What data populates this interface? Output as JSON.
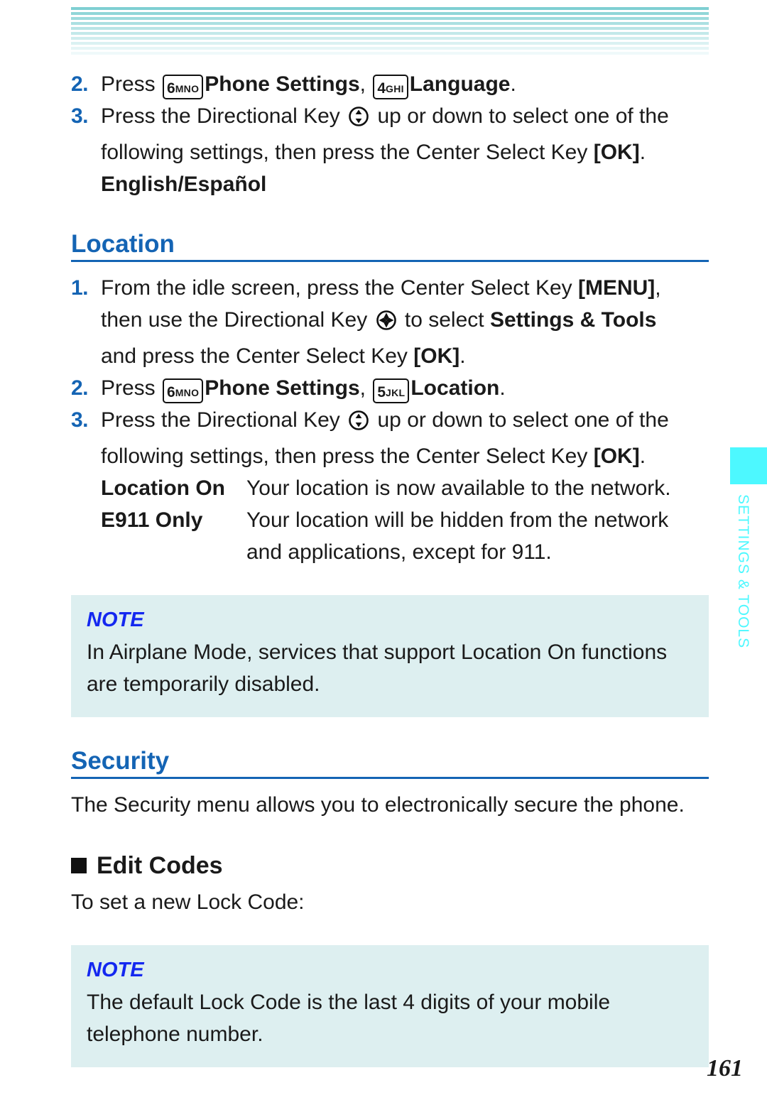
{
  "colors": {
    "heading_blue": "#1464b4",
    "note_label_blue": "#1428f0",
    "note_bg": "#ddeff0",
    "tab_cyan": "#4df8ff",
    "stripe_teal": "#7fcfd2"
  },
  "top_banner": {
    "kind": "striped-gradient-bar",
    "stripe_count": 10
  },
  "steps_language": [
    {
      "num": "2.",
      "pre": "Press ",
      "key1": {
        "num": "6",
        "letters": "MNO"
      },
      "bold1": "Phone Settings",
      "mid": ", ",
      "key2": {
        "num": "4",
        "letters": "GHI"
      },
      "bold2": "Language",
      "post": "."
    },
    {
      "num": "3.",
      "line1_pre": "Press the Directional Key ",
      "dirkey": "updown-dirkey-icon",
      "line1_post": " up or down to select one of the",
      "line2_pre": "following settings, then press the Center Select Key ",
      "line2_bold": "[OK]",
      "line2_post": "."
    }
  ],
  "language_option": "English/Español",
  "location_section": {
    "heading": "Location",
    "step1": {
      "num": "1.",
      "line1": "From the idle screen, press the Center Select Key ",
      "line1_bold": "[MENU]",
      "line1_post": ",",
      "line2_pre": "then use the Directional Key ",
      "dirkey": "fourway-dirkey-icon",
      "line2_mid": " to select ",
      "line2_bold": "Settings & Tools",
      "line3_pre": "and press the Center Select Key ",
      "line3_bold": "[OK]",
      "line3_post": "."
    },
    "step2": {
      "num": "2.",
      "pre": "Press ",
      "key1": {
        "num": "6",
        "letters": "MNO"
      },
      "bold1": "Phone Settings",
      "mid": ", ",
      "key2": {
        "num": "5",
        "letters": "JKL"
      },
      "bold2": "Location",
      "post": "."
    },
    "step3": {
      "num": "3.",
      "line1_pre": "Press the Directional Key ",
      "dirkey": "updown-dirkey-icon",
      "line1_post": " up or down to select one of the",
      "line2_pre": "following settings, then press the Center Select Key ",
      "line2_bold": "[OK]",
      "line2_post": "."
    },
    "options": [
      {
        "term": "Location On",
        "desc": "Your location is now available to the network."
      },
      {
        "term": "E911 Only",
        "desc": "Your location will be hidden from the network and applications, except for 911."
      }
    ],
    "note": {
      "title": "NOTE",
      "body": "In Airplane Mode, services that support Location On functions are temporarily disabled."
    }
  },
  "security_section": {
    "heading": "Security",
    "intro": "The Security menu allows you to electronically secure the phone.",
    "subheading": "Edit Codes",
    "subintro": "To set a new Lock Code:",
    "note": {
      "title": "NOTE",
      "body": "The default Lock Code is the last 4 digits of your mobile telephone number."
    }
  },
  "side_tab": {
    "label": "SETTINGS & TOOLS"
  },
  "page_number": "161"
}
